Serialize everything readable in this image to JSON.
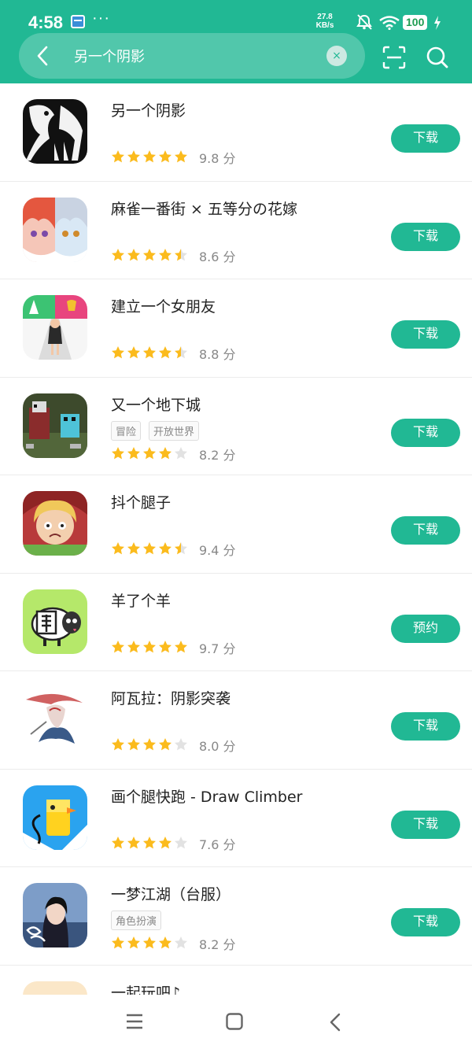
{
  "status_bar": {
    "time": "4:58",
    "dots": "···",
    "speed_value": "27.8",
    "speed_unit": "KB/s",
    "battery": "100",
    "icons": [
      "notification-icon",
      "mute-icon",
      "wifi-icon",
      "charging-icon"
    ]
  },
  "search": {
    "query": "另一个阴影",
    "clear_label": "×",
    "icons": [
      "back-icon",
      "scan-icon",
      "search-icon"
    ]
  },
  "colors": {
    "accent": "#21b894",
    "star": "#fbbb1d",
    "star_empty": "#e2e2e2"
  },
  "apps": [
    {
      "name": "另一个阴影",
      "tags": [],
      "stars": 5,
      "score": "9.8 分",
      "action": "下载",
      "icon": "shadow-icon"
    },
    {
      "name": "麻雀一番街 × 五等分の花嫁",
      "tags": [],
      "stars": 4.5,
      "score": "8.6 分",
      "action": "下载",
      "icon": "anime-girls-icon"
    },
    {
      "name": "建立一个女朋友",
      "tags": [],
      "stars": 4.5,
      "score": "8.8 分",
      "action": "下载",
      "icon": "girlfriend-runner-icon"
    },
    {
      "name": "又一个地下城",
      "tags": [
        "冒险",
        "开放世界"
      ],
      "stars": 4,
      "score": "8.2 分",
      "action": "下载",
      "icon": "pixel-dungeon-icon"
    },
    {
      "name": "抖个腿子",
      "tags": [],
      "stars": 4.5,
      "score": "9.4 分",
      "action": "下载",
      "icon": "crying-girl-icon"
    },
    {
      "name": "羊了个羊",
      "tags": [],
      "stars": 5,
      "score": "9.7 分",
      "action": "预约",
      "icon": "sheep-icon"
    },
    {
      "name": "阿瓦拉：阴影突袭",
      "tags": [],
      "stars": 4,
      "score": "8.0 分",
      "action": "下载",
      "icon": "warrior-icon"
    },
    {
      "name": "画个腿快跑 - Draw Climber",
      "tags": [],
      "stars": 4,
      "score": "7.6 分",
      "action": "下载",
      "icon": "duck-climber-icon"
    },
    {
      "name": "一梦江湖（台服）",
      "tags": [
        "角色扮演"
      ],
      "stars": 4,
      "score": "8.2 分",
      "action": "下载",
      "icon": "jianghu-icon"
    },
    {
      "name": "一起玩吧♪",
      "tags": [],
      "stars": 0,
      "score": "",
      "action": "",
      "icon": "partial-icon"
    }
  ],
  "nav": {
    "icons": [
      "menu-icon",
      "home-icon",
      "nav-back-icon"
    ]
  }
}
